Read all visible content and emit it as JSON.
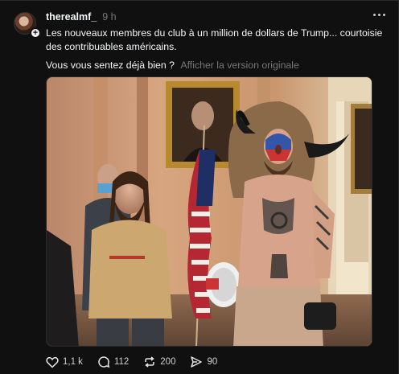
{
  "post": {
    "username": "therealmf_",
    "time": "9 h",
    "text_line1": "Les nouveaux membres du club à un million de dollars de Trump... courtoisie des contribuables américains.",
    "text_line2": "Vous vous sentez déjà bien ?",
    "translate_label": "Afficher la version originale",
    "image_icon": "photo-of-people-in-capitol-hallway"
  },
  "actions": {
    "like_count": "1,1 k",
    "comment_count": "112",
    "repost_count": "200",
    "share_count": "90"
  },
  "colors": {
    "background": "#101010",
    "text": "#f3f5f7",
    "muted": "#777777"
  }
}
